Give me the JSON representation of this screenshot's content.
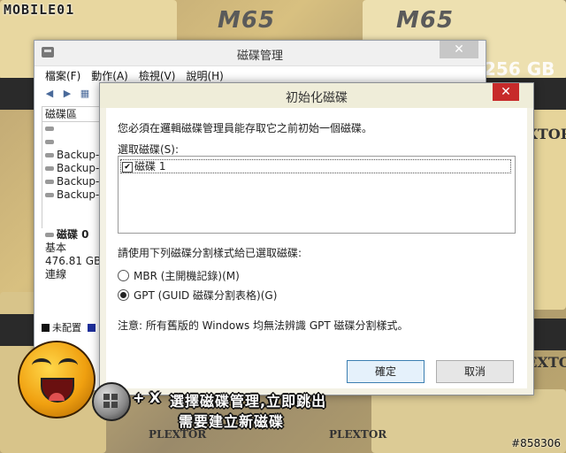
{
  "overlay": {
    "brand": "MOBILE01",
    "watermark_id": "#858306",
    "key_combo": "+ X",
    "caption_line1": "選擇磁碟管理,立即跳出",
    "caption_line2": "需要建立新磁碟"
  },
  "background": {
    "label_m65": "M65",
    "label_plextor": "PLEXTOR",
    "label_capacity": "256 GB"
  },
  "disk_mgmt": {
    "title": "磁碟管理",
    "close_glyph": "✕",
    "menu": [
      "檔案(F)",
      "動作(A)",
      "檢視(V)",
      "說明(H)"
    ],
    "list_header": "磁碟區",
    "volumes": [
      "",
      "",
      "Backup-D",
      "Backup-E",
      "Backup-G",
      "Backup-H"
    ],
    "disk_name": "磁碟 0",
    "disk_type": "基本",
    "disk_size": "476.81 GB",
    "disk_status": "連線",
    "legend_unallocated": "未配置"
  },
  "dialog": {
    "title": "初始化磁碟",
    "close_glyph": "✕",
    "intro": "您必須在邏輯磁碟管理員能存取它之前初始一個磁碟。",
    "select_label": "選取磁碟(S):",
    "disks": [
      {
        "label": "磁碟 1",
        "checked": true
      }
    ],
    "style_label": "請使用下列磁碟分割樣式給已選取磁碟:",
    "options": [
      {
        "label": "MBR (主開機記錄)(M)",
        "selected": false
      },
      {
        "label": "GPT (GUID 磁碟分割表格)(G)",
        "selected": true
      }
    ],
    "note": "注意: 所有舊版的 Windows 均無法辨識 GPT 磁碟分割樣式。",
    "ok_label": "確定",
    "cancel_label": "取消"
  }
}
